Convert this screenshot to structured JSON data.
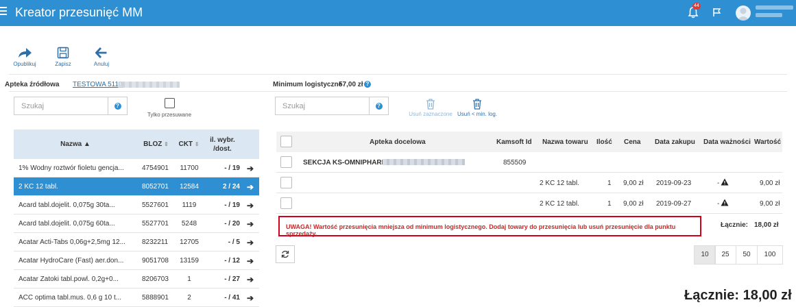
{
  "app": {
    "title": "Kreator przesunięć MM",
    "notification_count": "44"
  },
  "toolbar": {
    "publish": "Opublikuj",
    "save": "Zapisz",
    "cancel": "Anuluj"
  },
  "source": {
    "label": "Apteka źródłowa",
    "value": "TESTOWA 5110"
  },
  "minimum": {
    "label": "Minimum logistyczne",
    "value": "57,00 zł"
  },
  "left": {
    "search_placeholder": "Szukaj",
    "only_moved_label": "Tylko przesuwane",
    "headers": {
      "name": "Nazwa ▲",
      "bloz": "BLOZ",
      "ckt": "CKT",
      "qty_line1": "il. wybr.",
      "qty_line2": "/dost."
    },
    "rows": [
      {
        "name": "1% Wodny roztwór fioletu gencja...",
        "bloz": "4754901",
        "ckt": "11700",
        "qty": "- / 19"
      },
      {
        "name": "2 KC 12 tabl.",
        "bloz": "8052701",
        "ckt": "12584",
        "qty": "2 / 24",
        "selected": true
      },
      {
        "name": "Acard tabl.dojelit. 0,075g 30ta...",
        "bloz": "5527601",
        "ckt": "1119",
        "qty": "- / 19"
      },
      {
        "name": "Acard tabl.dojelit. 0,075g 60ta...",
        "bloz": "5527701",
        "ckt": "5248",
        "qty": "- / 20"
      },
      {
        "name": "Acatar Acti-Tabs 0,06g+2,5mg 12...",
        "bloz": "8232211",
        "ckt": "12705",
        "qty": "- / 5"
      },
      {
        "name": "Acatar HydroCare (Fast) aer.don...",
        "bloz": "9051708",
        "ckt": "13159",
        "qty": "- / 12"
      },
      {
        "name": "Acatar Zatoki tabl.powl. 0,2g+0...",
        "bloz": "8206703",
        "ckt": "1",
        "qty": "- / 27"
      },
      {
        "name": "ACC optima tabl.mus. 0,6 g 10 t...",
        "bloz": "5888901",
        "ckt": "2",
        "qty": "- / 41"
      }
    ]
  },
  "right": {
    "search_placeholder": "Szukaj",
    "delete_selected": "Usuń zaznaczone",
    "delete_min": "Usuń < min. log.",
    "headers": {
      "target": "Apteka docelowa",
      "kamsoft": "Kamsoft Id",
      "product": "Nazwa towaru",
      "qty": "Ilość",
      "price": "Cena",
      "purchase": "Data zakupu",
      "expiry": "Data ważności",
      "value": "Wartość"
    },
    "section": {
      "name": "SEKCJA KS-OMNIPHARM",
      "kamsoft": "855509"
    },
    "rows": [
      {
        "product": "2 KC 12 tabl.",
        "qty": "1",
        "price": "9,00 zł",
        "purchase": "2019-09-23",
        "expiry": "-",
        "value": "9,00 zł"
      },
      {
        "product": "2 KC 12 tabl.",
        "qty": "1",
        "price": "9,00 zł",
        "purchase": "2019-09-27",
        "expiry": "-",
        "value": "9,00 zł"
      }
    ],
    "warning": "UWAGA! Wartość przesunięcia mniejsza od minimum logistycznego. Dodaj towary do przesunięcia lub usuń przesunięcie dla punktu sprzedaży.",
    "sum_label": "Łącznie:",
    "sum_value": "18,00 zł",
    "page_sizes": [
      "10",
      "25",
      "50",
      "100"
    ],
    "total": "Łącznie: 18,00 zł"
  }
}
